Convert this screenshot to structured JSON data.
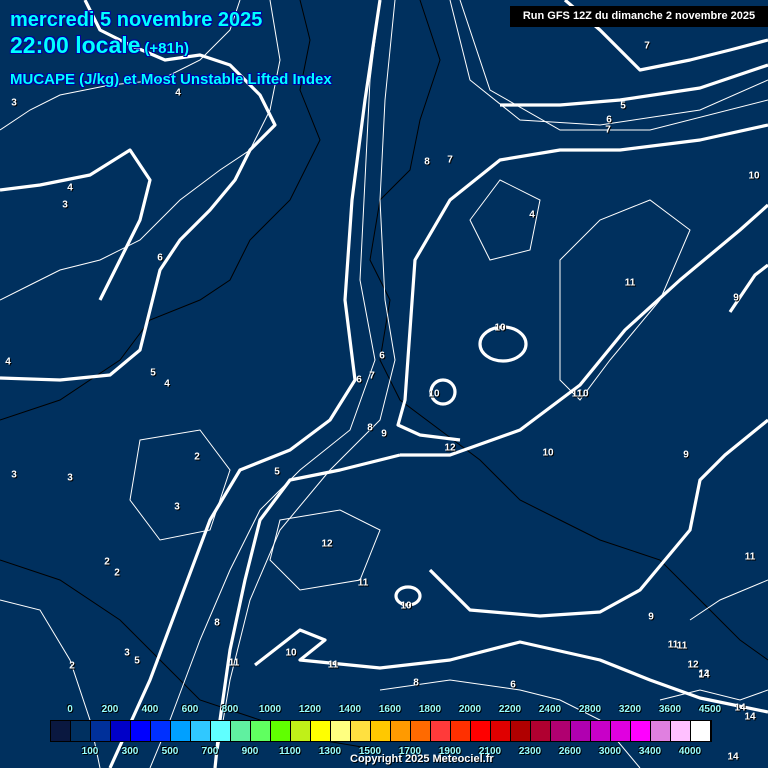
{
  "header": {
    "date": "mercredi 5 novembre 2025",
    "time": "22:00 locale",
    "lead": "(+81h)",
    "parameter": "MUCAPE (J/kg) et Most Unstable Lifted Index",
    "run": "Run GFS 12Z du dimanche 2 novembre 2025"
  },
  "contour_labels": [
    "3",
    "4",
    "4",
    "3",
    "6",
    "5",
    "4",
    "4",
    "3",
    "3",
    "2",
    "3",
    "5",
    "2",
    "2",
    "8",
    "3",
    "5",
    "2",
    "10",
    "11",
    "11",
    "12",
    "11",
    "10",
    "6",
    "7",
    "6",
    "7",
    "8",
    "9",
    "10",
    "10",
    "8",
    "7",
    "5",
    "6",
    "7",
    "4",
    "11",
    "12",
    "10",
    "11",
    "10",
    "9",
    "9",
    "10",
    "9",
    "11",
    "11",
    "11",
    "12",
    "13",
    "14",
    "14",
    "14",
    "14",
    "6",
    "8"
  ],
  "legend": {
    "colors": [
      "#0a1840",
      "#003060",
      "#00309a",
      "#0000c8",
      "#0000ff",
      "#0030ff",
      "#00a0ff",
      "#30c8ff",
      "#60ffff",
      "#60f0a0",
      "#60ff60",
      "#60ff00",
      "#c0f018",
      "#ffff00",
      "#ffff80",
      "#ffe040",
      "#ffc800",
      "#ff9a00",
      "#ff6a00",
      "#ff3a3a",
      "#ff3000",
      "#ff0000",
      "#e00000",
      "#b00000",
      "#b00030",
      "#b00070",
      "#b000b0",
      "#c800c8",
      "#e000e0",
      "#ff00ff",
      "#e080e0",
      "#ffc0ff",
      "#ffffff"
    ],
    "top_labels": [
      "0",
      "200",
      "400",
      "600",
      "800",
      "1000",
      "1200",
      "1400",
      "1600",
      "1800",
      "2000",
      "2200",
      "2400",
      "2800",
      "3200",
      "3600",
      "4500"
    ],
    "bottom_labels": [
      "100",
      "300",
      "500",
      "700",
      "900",
      "1100",
      "1300",
      "1500",
      "1700",
      "1900",
      "2100",
      "2300",
      "2600",
      "3000",
      "3400",
      "4000"
    ]
  },
  "copyright": "Copyright 2025 Meteociel.fr"
}
